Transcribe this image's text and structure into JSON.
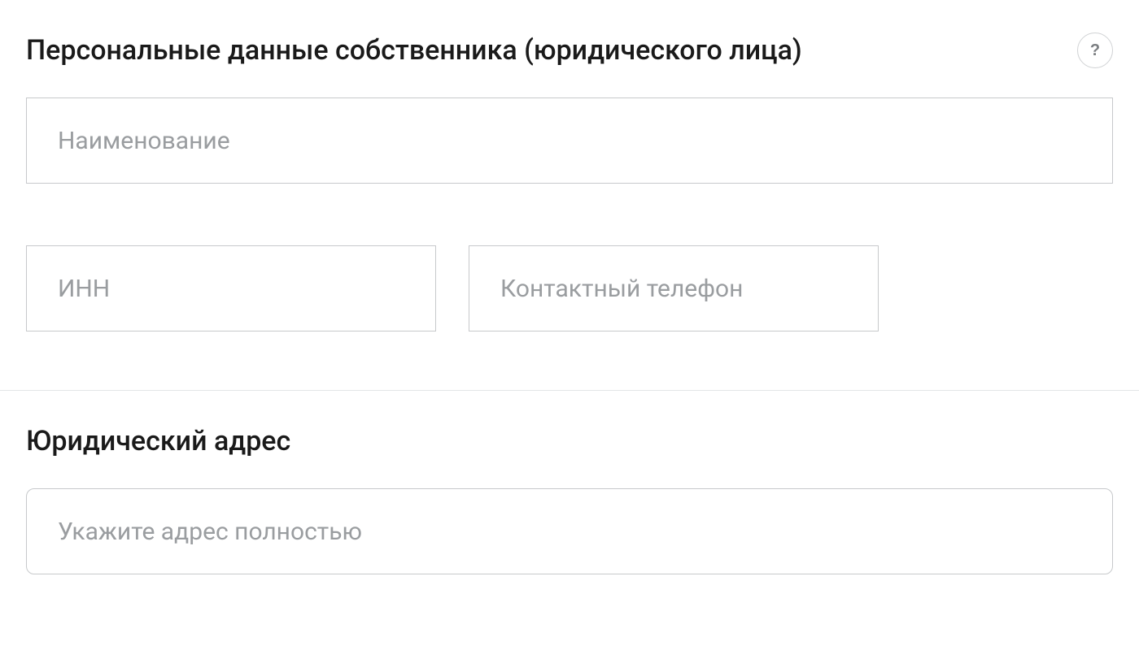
{
  "section_personal": {
    "title": "Персональные данные собственника (юридического лица)",
    "help_label": "?",
    "fields": {
      "name_placeholder": "Наименование",
      "inn_placeholder": "ИНН",
      "phone_placeholder": "Контактный телефон"
    }
  },
  "section_address": {
    "title": "Юридический адрес",
    "fields": {
      "address_placeholder": "Укажите адрес полностью"
    }
  }
}
